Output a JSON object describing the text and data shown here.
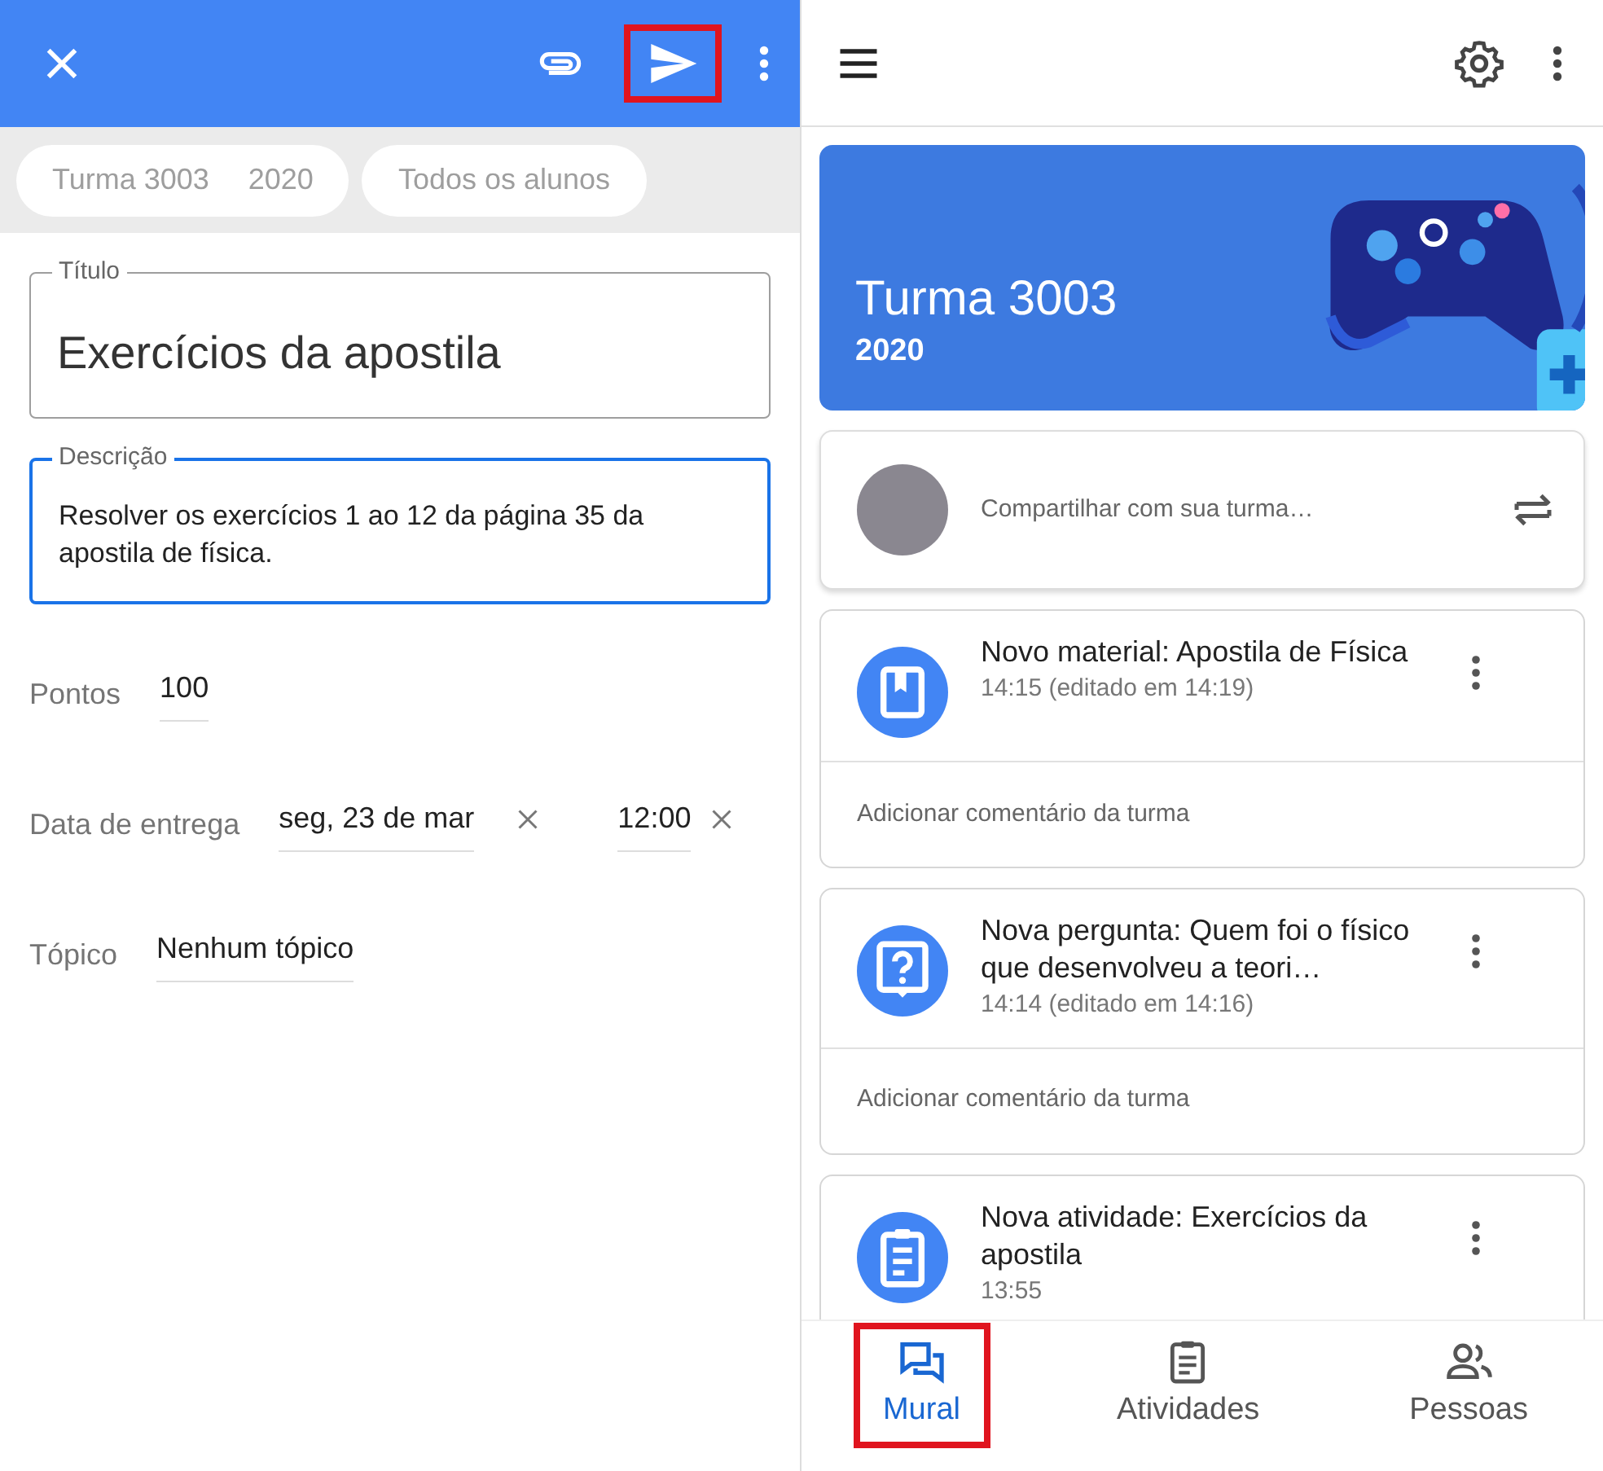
{
  "assignment_editor": {
    "toolbar": {
      "send_highlighted": true
    },
    "chips": [
      {
        "texts": [
          "Turma 3003",
          "2020"
        ]
      },
      {
        "texts": [
          "Todos os alunos"
        ]
      }
    ],
    "title_field": {
      "label": "Título",
      "value": "Exercícios da apostila",
      "focused": false
    },
    "description_field": {
      "label": "Descrição",
      "value": "Resolver os exercícios 1 ao 12 da página 35 da apostila de física.",
      "focused": true
    },
    "points": {
      "label": "Pontos",
      "value": "100"
    },
    "due": {
      "label": "Data de entrega",
      "date": "seg, 23 de mar",
      "time": "12:00"
    },
    "topic": {
      "label": "Tópico",
      "value": "Nenhum tópico"
    }
  },
  "class_stream": {
    "banner": {
      "title": "Turma 3003",
      "subtitle": "2020"
    },
    "share": {
      "placeholder": "Compartilhar com sua turma…"
    },
    "posts": [
      {
        "kind": "material",
        "title": "Novo material: Apostila de Física",
        "time": "14:15 (editado em 14:19)",
        "comment_placeholder": "Adicionar comentário da turma"
      },
      {
        "kind": "question",
        "title": "Nova pergunta: Quem foi o físico que desenvolveu a teori…",
        "time": "14:14 (editado em 14:16)",
        "comment_placeholder": "Adicionar comentário da turma"
      },
      {
        "kind": "assignment",
        "title": "Nova atividade: Exercícios da apostila",
        "time": "13:55"
      }
    ],
    "bottom_nav": [
      {
        "kind": "stream",
        "label": "Mural",
        "selected": true,
        "highlighted": true
      },
      {
        "kind": "classwork",
        "label": "Atividades",
        "selected": false,
        "highlighted": false
      },
      {
        "kind": "people",
        "label": "Pessoas",
        "selected": false,
        "highlighted": false
      }
    ]
  }
}
